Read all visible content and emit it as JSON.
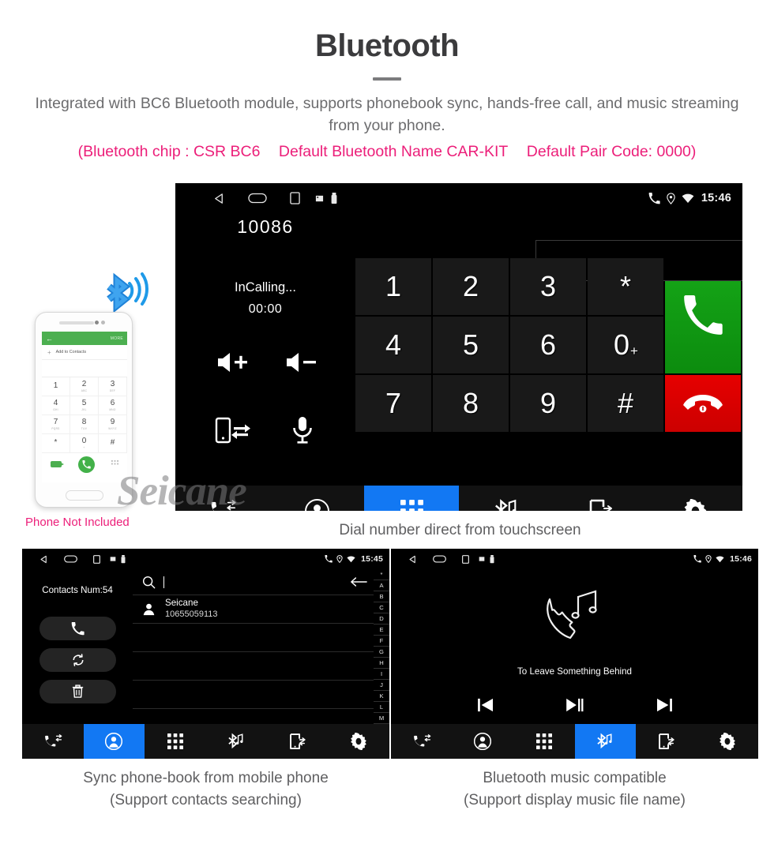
{
  "header": {
    "title": "Bluetooth",
    "subtitle": "Integrated with BC6 Bluetooth module, supports phonebook sync, hands-free call, and music streaming from your phone.",
    "spec_chip": "(Bluetooth chip : CSR BC6",
    "spec_name": "Default Bluetooth Name CAR-KIT",
    "spec_pair": "Default Pair Code: 0000)",
    "accent_pink": "#ec1e79",
    "title_color": "#3b3b3d"
  },
  "captions": {
    "main": "Dial number direct from touchscreen",
    "left_line1": "Sync phone-book from mobile phone",
    "left_line2": "(Support contacts searching)",
    "right_line1": "Bluetooth music compatible",
    "right_line2": "(Support display music file name)"
  },
  "watermark": {
    "text": "Seicane"
  },
  "phone_mockup": {
    "note": "Phone Not Included",
    "topbar_more": "MORE",
    "add_contacts": "Add to Contacts",
    "keys": [
      {
        "digit": "1",
        "letters": ""
      },
      {
        "digit": "2",
        "letters": "ABC"
      },
      {
        "digit": "3",
        "letters": "DEF"
      },
      {
        "digit": "4",
        "letters": "GHI"
      },
      {
        "digit": "5",
        "letters": "JKL"
      },
      {
        "digit": "6",
        "letters": "MNO"
      },
      {
        "digit": "7",
        "letters": "PQRS"
      },
      {
        "digit": "8",
        "letters": "TUV"
      },
      {
        "digit": "9",
        "letters": "WXYZ"
      },
      {
        "digit": "*",
        "letters": ""
      },
      {
        "digit": "0",
        "letters": "+"
      },
      {
        "digit": "#",
        "letters": ""
      }
    ]
  },
  "dialer": {
    "status_bar": {
      "time": "15:46"
    },
    "dialed_number": "10086",
    "call_status": "InCalling...",
    "call_timer": "00:00",
    "input_value": "",
    "controls": [
      {
        "name": "volume-up",
        "label": "Volume Up"
      },
      {
        "name": "volume-down",
        "label": "Volume Down"
      },
      {
        "name": "transfer-to-phone",
        "label": "Transfer To Phone"
      },
      {
        "name": "microphone-mute",
        "label": "Microphone"
      }
    ],
    "keys": [
      "1",
      "2",
      "3",
      "*",
      "4",
      "5",
      "6",
      "0",
      "7",
      "8",
      "9",
      "#"
    ],
    "zero_superscript": "+",
    "call_button": "Call",
    "end_button": "End Call",
    "active_tab": "keypad"
  },
  "contacts_panel": {
    "status_bar": {
      "time": "15:45"
    },
    "contacts_count_label": "Contacts Num:54",
    "search_value": "",
    "side_buttons": [
      {
        "name": "call-button",
        "label": "Call"
      },
      {
        "name": "sync-button",
        "label": "Sync"
      },
      {
        "name": "delete-button",
        "label": "Delete"
      }
    ],
    "rows": [
      {
        "name": "Seicane",
        "phone": "10655059113"
      }
    ],
    "empty_rows": 3,
    "az_index": [
      "*",
      "A",
      "B",
      "C",
      "D",
      "E",
      "F",
      "G",
      "H",
      "I",
      "J",
      "K",
      "L",
      "M"
    ],
    "active_tab": "contacts"
  },
  "music_panel": {
    "status_bar": {
      "time": "15:46"
    },
    "track_title": "To Leave Something Behind",
    "controls": [
      {
        "name": "previous-track",
        "label": "Previous"
      },
      {
        "name": "play-pause",
        "label": "Play / Pause"
      },
      {
        "name": "next-track",
        "label": "Next"
      }
    ],
    "active_tab": "bluetooth-music"
  },
  "navbar": {
    "items": [
      {
        "key": "call-history",
        "label": "Call History"
      },
      {
        "key": "contacts",
        "label": "Contacts"
      },
      {
        "key": "keypad",
        "label": "Keypad"
      },
      {
        "key": "bluetooth-music",
        "label": "Bluetooth Music"
      },
      {
        "key": "phone-link",
        "label": "Phone Link"
      },
      {
        "key": "settings",
        "label": "Settings"
      }
    ],
    "active_color": "#1278f3"
  }
}
